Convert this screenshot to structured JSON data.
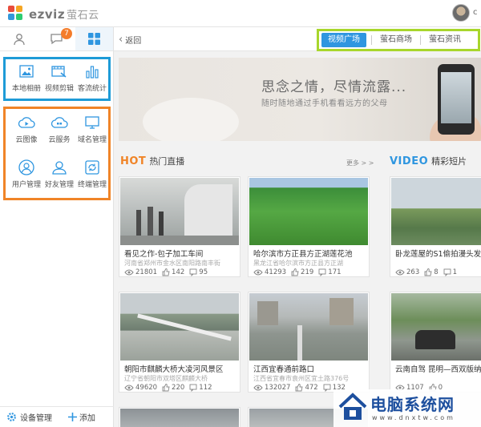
{
  "app": {
    "logo_text": "ezviz",
    "logo_cn": "萤石云",
    "user_partial": "c"
  },
  "sidebar": {
    "tabs": [
      {
        "name": "user-icon"
      },
      {
        "name": "chat-icon",
        "badge": "7"
      },
      {
        "name": "grid-apps-icon",
        "active": true
      }
    ],
    "group1": [
      {
        "label": "本地相册",
        "icon": "photo-icon"
      },
      {
        "label": "视频剪辑",
        "icon": "video-edit-icon"
      },
      {
        "label": "客流统计",
        "icon": "bar-stats-icon"
      }
    ],
    "group2": [
      {
        "label": "云图像",
        "icon": "cloud-play-icon"
      },
      {
        "label": "云服务",
        "icon": "cloud-service-icon"
      },
      {
        "label": "域名管理",
        "icon": "monitor-icon"
      },
      {
        "label": "用户管理",
        "icon": "user-manage-icon"
      },
      {
        "label": "好友管理",
        "icon": "friends-icon"
      },
      {
        "label": "终端管理",
        "icon": "terminal-sync-icon"
      }
    ],
    "bottom": {
      "device_manage": "设备管理",
      "add": "添加"
    }
  },
  "topnav": {
    "back": "返回",
    "tabs": [
      "视频广场",
      "萤石商场",
      "萤石资讯"
    ],
    "active_tab": 0
  },
  "banner": {
    "title": "思念之情，尽情流露...",
    "subtitle": "随时随地通过手机看看远方的父母"
  },
  "hot": {
    "en": "HOT",
    "cn": "热门直播",
    "more": "更多 > >"
  },
  "video": {
    "en": "VIDEO",
    "cn": "精彩短片"
  },
  "cards": [
    {
      "title": "看见之作-包子加工车间",
      "loc": "河南省郑州市金水区南阳路南丰街",
      "views": "21801",
      "likes": "142",
      "comments": "95"
    },
    {
      "title": "哈尔滨市方正县方正湖莲花池",
      "loc": "黑龙江省哈尔滨市方正县方正湖",
      "views": "41293",
      "likes": "219",
      "comments": "171"
    },
    {
      "title": "卧龙莲屋的S1偷拍漫头发展",
      "loc": "",
      "views": "263",
      "likes": "8",
      "comments": "1"
    },
    {
      "title": "朝阳市麒麟大桥大凌河风景区",
      "loc": "辽宁省朝阳市双塔区麒麟大桥",
      "views": "49620",
      "likes": "220",
      "comments": "112"
    },
    {
      "title": "江西宜春通前路口",
      "loc": "江西省宜春市袁州区宜土路376号",
      "views": "132027",
      "likes": "472",
      "comments": "132"
    },
    {
      "title": "云南自驾 昆明—西双版纳",
      "loc": "",
      "views": "1107",
      "likes": "0",
      "comments": ""
    }
  ],
  "watermark": {
    "title": "电脑系统网",
    "url": "www.dnxtw.com"
  },
  "colors": {
    "accent_blue": "#2f96e0",
    "hot_orange": "#f08427",
    "annot_blue": "#1e9bd7",
    "annot_orange": "#f08427",
    "annot_green": "#a8d62c"
  }
}
